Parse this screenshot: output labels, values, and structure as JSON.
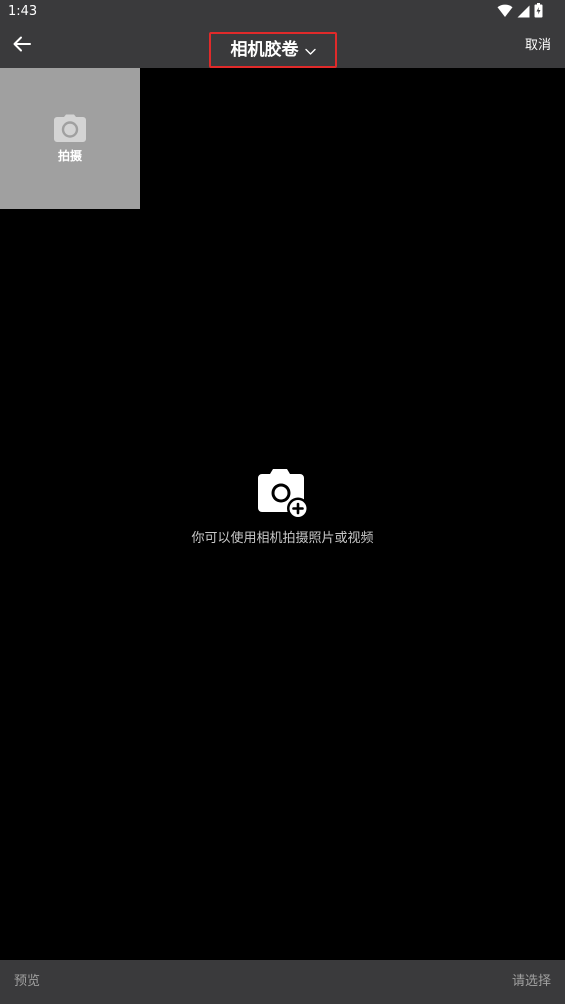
{
  "status_bar": {
    "time": "1:43",
    "icons": [
      "wifi-icon",
      "cellular-signal-icon",
      "battery-icon"
    ]
  },
  "header": {
    "back_icon": "back-arrow-icon",
    "title": "相机胶卷",
    "title_icon": "chevron-down-icon",
    "cancel_label": "取消",
    "highlight_color": "#e02a2a"
  },
  "grid": {
    "capture_tile": {
      "icon": "camera-icon",
      "label": "拍摄"
    }
  },
  "empty_state": {
    "icon": "camera-add-icon",
    "message": "你可以使用相机拍摄照片或视频"
  },
  "footer": {
    "preview_label": "预览",
    "select_label": "请选择"
  },
  "colors": {
    "bar_background": "#3a3a3c",
    "content_background": "#000000",
    "tile_background": "#a0a0a0",
    "disabled_text": "#a0a0a0"
  }
}
